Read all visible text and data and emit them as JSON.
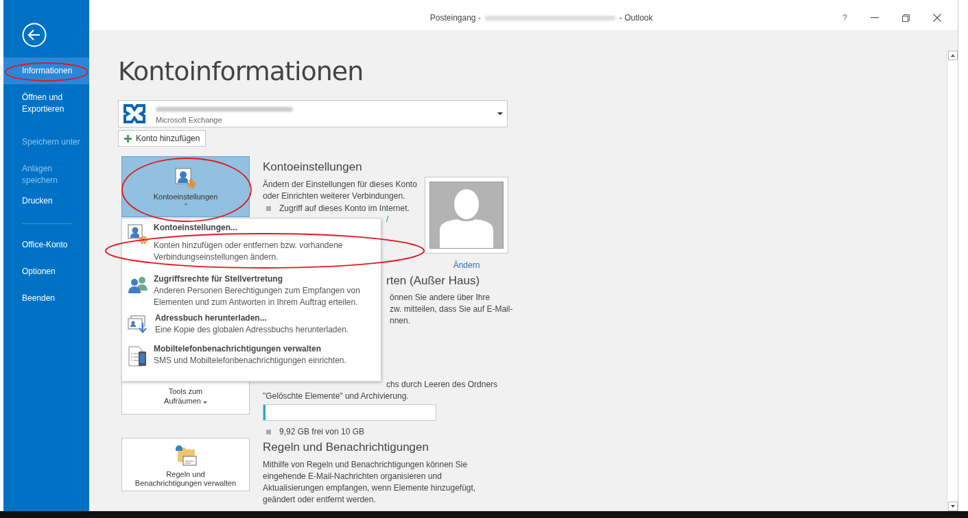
{
  "window": {
    "title_prefix": "Posteingang -",
    "title_suffix": "- Outlook",
    "help": "?"
  },
  "sidebar": {
    "groups": [
      [
        {
          "label": "Informationen",
          "selected": true,
          "disabled": false
        },
        {
          "label": "Öffnen und Exportieren",
          "selected": false,
          "disabled": false
        },
        {
          "label": "Speichern unter",
          "selected": false,
          "disabled": true
        },
        {
          "label": "Anlagen speichern",
          "selected": false,
          "disabled": true
        },
        {
          "label": "Drucken",
          "selected": false,
          "disabled": false
        }
      ],
      [
        {
          "label": "Office-Konto",
          "selected": false,
          "disabled": false
        },
        {
          "label": "Optionen",
          "selected": false,
          "disabled": false
        },
        {
          "label": "Beenden",
          "selected": false,
          "disabled": false
        }
      ]
    ]
  },
  "page_title": "Kontoinformationen",
  "account": {
    "type": "Microsoft Exchange"
  },
  "add_account": "Konto hinzufügen",
  "account_settings": {
    "button": "Kontoeinstellungen",
    "expanded": true,
    "heading": "Kontoeinstellungen",
    "description": "Ändern der Einstellungen für dieses Konto oder Einrichten weiterer Verbindungen.",
    "bullet": "Zugriff auf dieses Konto im Internet.",
    "link_fragment": "/",
    "photo_link": "Ändern"
  },
  "menu": [
    {
      "title": "Kontoeinstellungen...",
      "description": "Konten hinzufügen oder entfernen bzw. vorhandene Verbindungseinstellungen ändern."
    },
    {
      "title": "Zugriffsrechte für Stellvertretung",
      "description": "Anderen Personen Berechtigungen zum Empfangen von Elementen und zum Antworten in Ihrem Auftrag erteilen."
    },
    {
      "title": "Adressbuch herunterladen...",
      "description": "Eine Kopie des globalen Adressbuchs herunterladen."
    },
    {
      "title": "Mobiltelefonbenachrichtigungen verwalten",
      "description": "SMS und Mobiltelefonbenachrichtigungen einrichten."
    }
  ],
  "auto_reply": {
    "heading": "rten (Außer Haus)",
    "lines": [
      "önnen Sie andere über Ihre",
      "zw. mitteilen, dass Sie auf E-Mail-",
      "nnen."
    ]
  },
  "cleanup": {
    "button": [
      "Tools zum",
      "Aufräumen"
    ],
    "lines": [
      "chs durch Leeren des Ordners",
      "\"Gelöschte Elemente\" und Archivierung."
    ],
    "storage": {
      "level": 0.01
    },
    "bullet": "9,92 GB frei von 10 GB"
  },
  "rules": {
    "button": [
      "Regeln und",
      "Benachrichtigungen verwalten"
    ],
    "heading": "Regeln und Benachrichtigungen",
    "description": "Mithilfe von Regeln und Benachrichtigungen können Sie eingehende E-Mail-Nachrichten organisieren und Aktualisierungen empfangen, wenn Elemente hinzugefügt, geändert oder entfernt werden."
  }
}
